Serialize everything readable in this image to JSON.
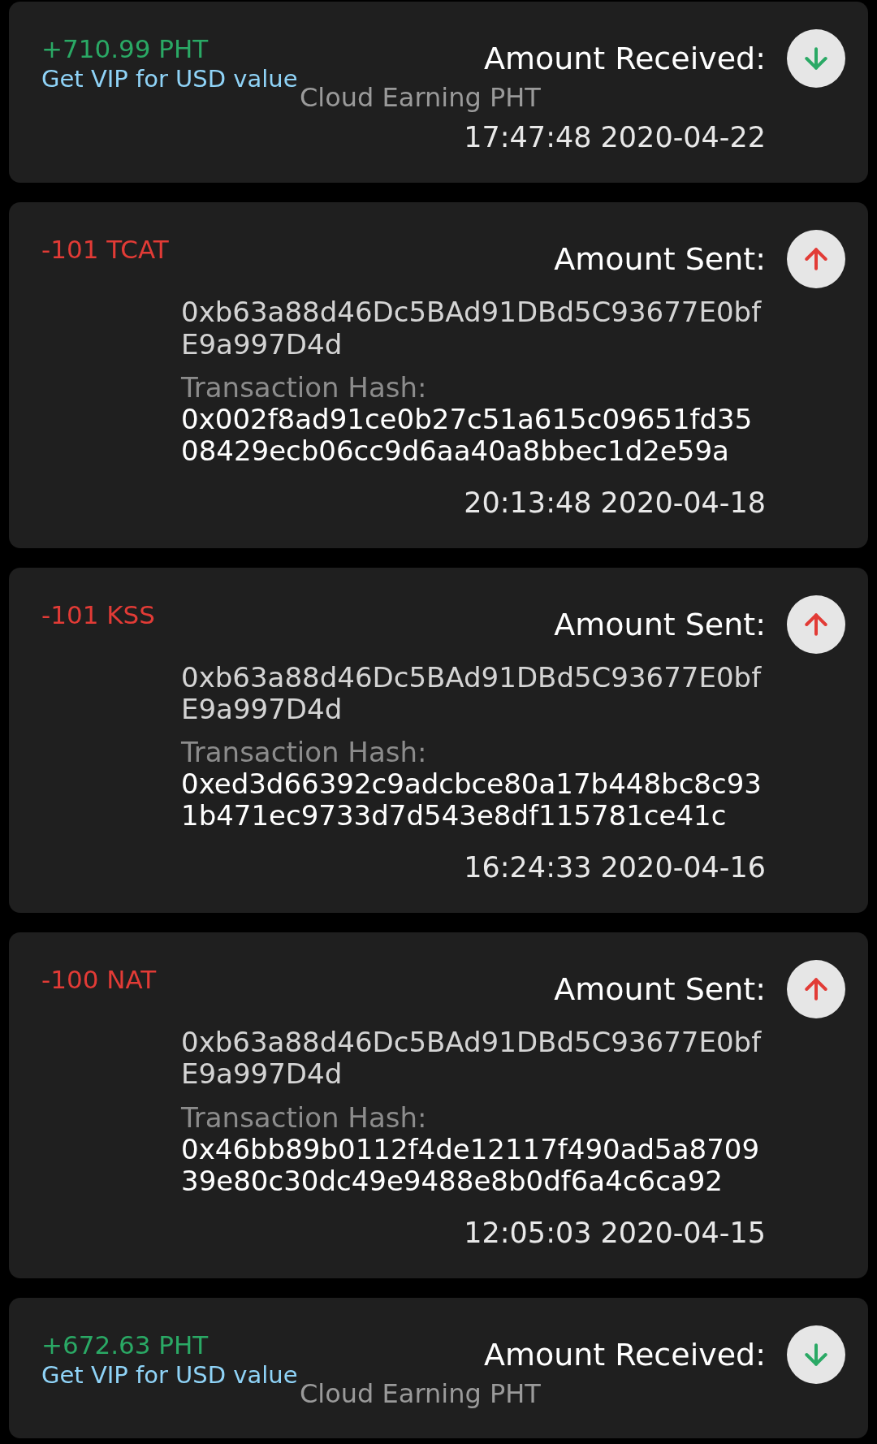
{
  "transactions": [
    {
      "kind": "received",
      "amount": "+710.99 PHT",
      "vip_link": "Get VIP for USD value",
      "title": "Amount Received:",
      "source": "Cloud Earning PHT",
      "time": "17:47:48 2020-04-22"
    },
    {
      "kind": "sent",
      "amount": "-101 TCAT",
      "title": "Amount Sent:",
      "address": "0xb63a88d46Dc5BAd91DBd5C93677E0bfE9a997D4d",
      "hash_label": "Transaction Hash:",
      "hash": "0x002f8ad91ce0b27c51a615c09651fd3508429ecb06cc9d6aa40a8bbec1d2e59a",
      "time": "20:13:48 2020-04-18"
    },
    {
      "kind": "sent",
      "amount": "-101 KSS",
      "title": "Amount Sent:",
      "address": "0xb63a88d46Dc5BAd91DBd5C93677E0bfE9a997D4d",
      "hash_label": "Transaction Hash:",
      "hash": "0xed3d66392c9adcbce80a17b448bc8c931b471ec9733d7d543e8df115781ce41c",
      "time": "16:24:33 2020-04-16"
    },
    {
      "kind": "sent",
      "amount": "-100 NAT",
      "title": "Amount Sent:",
      "address": "0xb63a88d46Dc5BAd91DBd5C93677E0bfE9a997D4d",
      "hash_label": "Transaction Hash:",
      "hash": "0x46bb89b0112f4de12117f490ad5a870939e80c30dc49e9488e8b0df6a4c6ca92",
      "time": "12:05:03 2020-04-15"
    },
    {
      "kind": "received",
      "amount": "+672.63 PHT",
      "vip_link": "Get VIP for USD value",
      "title": "Amount Received:",
      "source": "Cloud Earning PHT"
    }
  ]
}
